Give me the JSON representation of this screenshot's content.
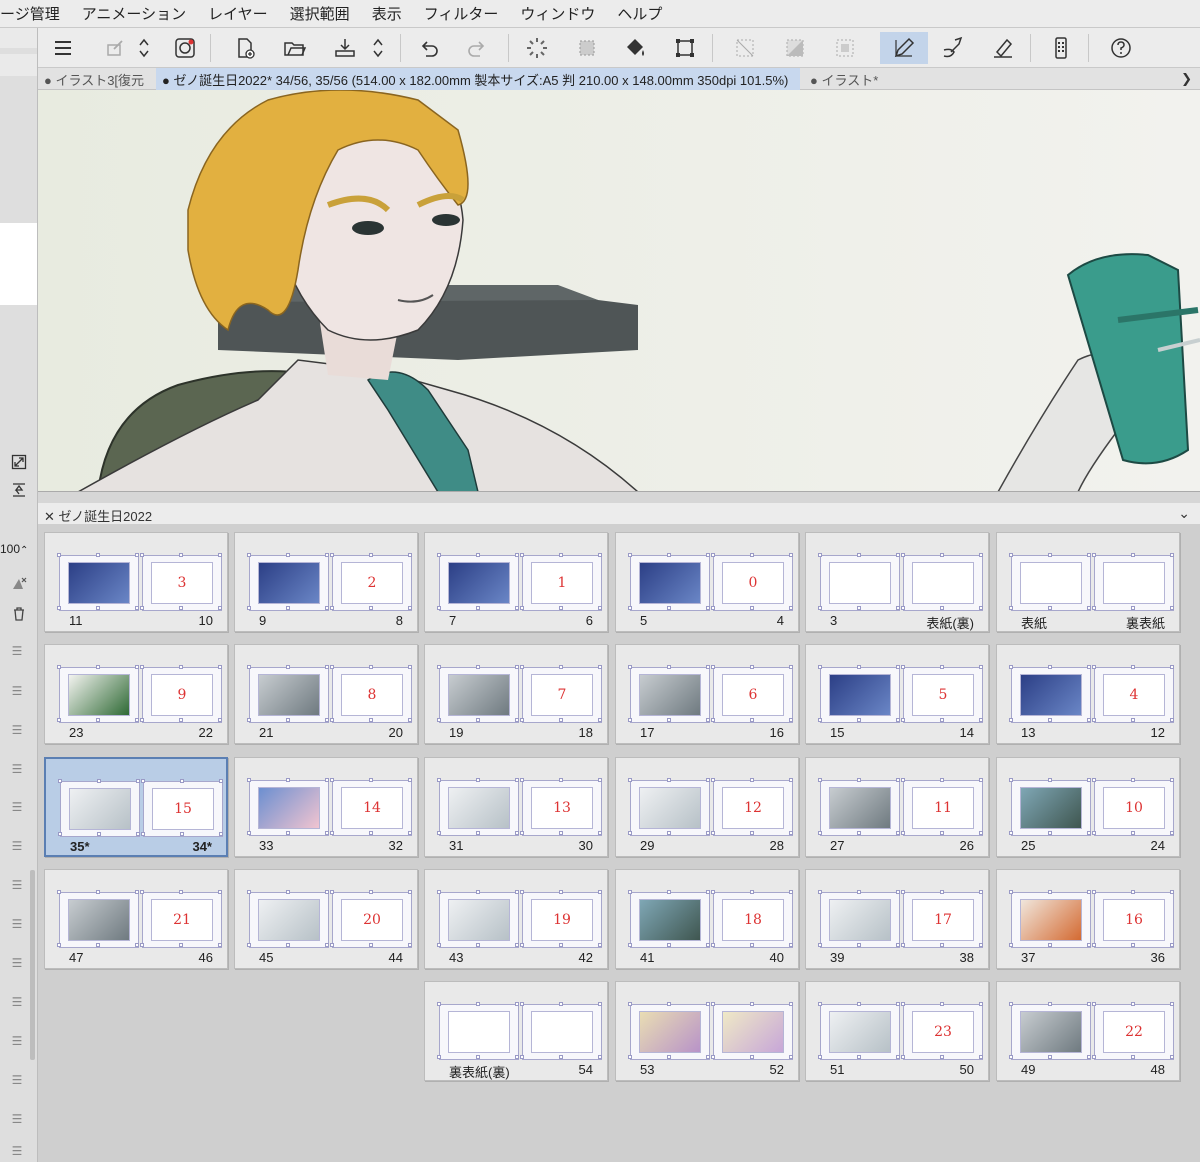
{
  "menubar": {
    "items": [
      "ページ管理",
      "アニメーション",
      "レイヤー",
      "選択範囲",
      "表示",
      "フィルター",
      "ウィンドウ",
      "ヘルプ"
    ],
    "first_item_visible": "ージ管理"
  },
  "tabs": {
    "items": [
      {
        "label": "● イラスト3[復元",
        "active": false
      },
      {
        "label": "● ゼノ誕生日2022* 34/56, 35/56 (514.00 x 182.00mm 製本サイズ:A5 判 210.00 x 148.00mm 350dpi 101.5%)",
        "active": true
      },
      {
        "label": "● イラスト*",
        "active": false
      }
    ]
  },
  "left_panel": {
    "zoom_value": "100"
  },
  "page_manager": {
    "title": "ゼノ誕生日2022",
    "spreads": [
      {
        "left": "11",
        "right": "10",
        "right_num": "3",
        "left_thumb": "blue",
        "selected": false
      },
      {
        "left": "9",
        "right": "8",
        "right_num": "2",
        "left_thumb": "blue",
        "selected": false
      },
      {
        "left": "7",
        "right": "6",
        "right_num": "1",
        "left_thumb": "blue",
        "selected": false
      },
      {
        "left": "5",
        "right": "4",
        "right_num": "0",
        "left_thumb": "blue",
        "selected": false
      },
      {
        "left": "3",
        "right": "表紙(裏)",
        "right_num": "",
        "left_thumb": "blank",
        "selected": false
      },
      {
        "left": "表紙",
        "right": "裏表紙",
        "right_num": "",
        "left_thumb": "blank",
        "selected": false
      },
      {
        "left": "23",
        "right": "22",
        "right_num": "9",
        "left_thumb": "green",
        "selected": false
      },
      {
        "left": "21",
        "right": "20",
        "right_num": "8",
        "left_thumb": "grey",
        "selected": false
      },
      {
        "left": "19",
        "right": "18",
        "right_num": "7",
        "left_thumb": "grey",
        "selected": false
      },
      {
        "left": "17",
        "right": "16",
        "right_num": "6",
        "left_thumb": "grey",
        "selected": false
      },
      {
        "left": "15",
        "right": "14",
        "right_num": "5",
        "left_thumb": "blue",
        "selected": false
      },
      {
        "left": "13",
        "right": "12",
        "right_num": "4",
        "left_thumb": "blue",
        "selected": false
      },
      {
        "left": "35*",
        "right": "34*",
        "right_num": "15",
        "left_thumb": "light",
        "selected": true
      },
      {
        "left": "33",
        "right": "32",
        "right_num": "14",
        "left_thumb": "blue-light",
        "selected": false
      },
      {
        "left": "31",
        "right": "30",
        "right_num": "13",
        "left_thumb": "light",
        "selected": false
      },
      {
        "left": "29",
        "right": "28",
        "right_num": "12",
        "left_thumb": "light",
        "selected": false
      },
      {
        "left": "27",
        "right": "26",
        "right_num": "11",
        "left_thumb": "grey",
        "selected": false
      },
      {
        "left": "25",
        "right": "24",
        "right_num": "10",
        "left_thumb": "teal",
        "selected": false
      },
      {
        "left": "47",
        "right": "46",
        "right_num": "21",
        "left_thumb": "grey",
        "selected": false
      },
      {
        "left": "45",
        "right": "44",
        "right_num": "20",
        "left_thumb": "light",
        "selected": false
      },
      {
        "left": "43",
        "right": "42",
        "right_num": "19",
        "left_thumb": "light",
        "selected": false
      },
      {
        "left": "41",
        "right": "40",
        "right_num": "18",
        "left_thumb": "teal",
        "selected": false
      },
      {
        "left": "39",
        "right": "38",
        "right_num": "17",
        "left_thumb": "light",
        "selected": false
      },
      {
        "left": "37",
        "right": "36",
        "right_num": "16",
        "left_thumb": "orange",
        "selected": false
      },
      {
        "left": "裏表紙(裏)",
        "right": "54",
        "right_num": "",
        "left_thumb": "blank",
        "selected": false
      },
      {
        "left": "53",
        "right": "52",
        "right_num": "",
        "left_thumb": "wide",
        "selected": false
      },
      {
        "left": "51",
        "right": "50",
        "right_num": "23",
        "left_thumb": "light",
        "selected": false
      },
      {
        "left": "49",
        "right": "48",
        "right_num": "22",
        "left_thumb": "grey",
        "selected": false
      }
    ]
  },
  "colors": {
    "accent": "#c3d4ea",
    "selected_spread": "#b9cde6",
    "page_number_red": "#dd3333"
  }
}
